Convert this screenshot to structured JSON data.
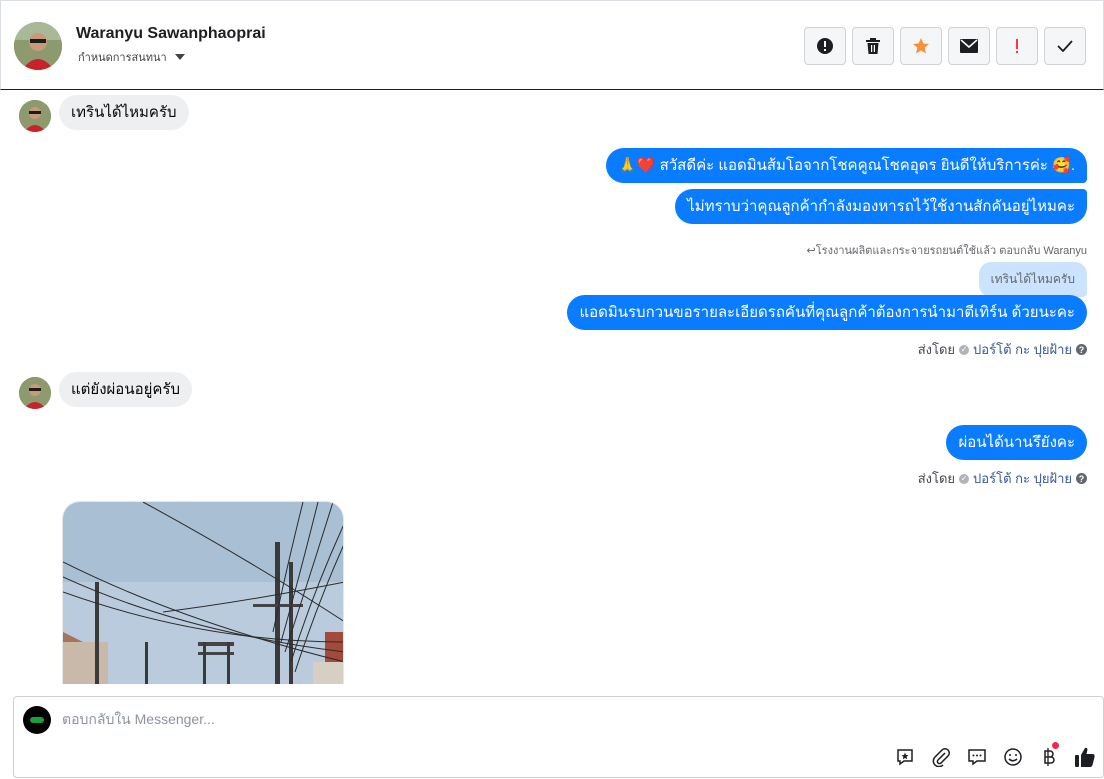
{
  "header": {
    "contact_name": "Waranyu Sawanphaoprai",
    "label_select": "กำหนดการสนทนา",
    "actions": [
      {
        "name": "mark-spam",
        "icon": "alert-circle-icon"
      },
      {
        "name": "delete",
        "icon": "trash-icon"
      },
      {
        "name": "star",
        "icon": "star-icon",
        "color": "#f7923b"
      },
      {
        "name": "mark-unread",
        "icon": "envelope-icon"
      },
      {
        "name": "follow-up",
        "icon": "exclamation-icon",
        "color": "#fa383e"
      },
      {
        "name": "mark-done",
        "icon": "checkmark-icon"
      }
    ]
  },
  "messages": {
    "m1": "เทรินได้ไหมครับ",
    "m2": "🙏❤️ สวัสดีค่ะ แอดมินส้มโอจากโชคคูณโชคอุดร ยินดีให้บริการค่ะ 🥰.",
    "m3": "ไม่ทราบว่าคุณลูกค้ากำลังมองหารถไว้ใช้งานสักคันอยู่ไหมคะ",
    "reply_meta": "โรงงานผลิตและกระจายรถยนต์ใช้แล้ว ตอบกลับ Waranyu",
    "quoted": "เทรินได้ไหมครับ",
    "m4": "แอดมินรบกวนขอรายละเอียดรถคันที่คุณลูกค้าต้องการนำมาตีเทิร์น ด้วยนะคะ",
    "m5": "แต่ยังผ่อนอยู่ครับ",
    "m6": "ผ่อนได้นานรึยังคะ"
  },
  "sent_by": {
    "label": "ส่งโดย",
    "agent": "ปอร์โต้ กะ ปุยฝ้าย"
  },
  "composer": {
    "placeholder": "ตอบกลับใน Messenger...",
    "tools": [
      "saved-reply-icon",
      "attachment-icon",
      "message-icon",
      "emoji-icon",
      "baht-payment-icon",
      "thumbs-up-icon"
    ]
  },
  "colors": {
    "outgoing": "#0a7cff",
    "incoming": "#eeeff1",
    "quote": "#cce3ff"
  }
}
